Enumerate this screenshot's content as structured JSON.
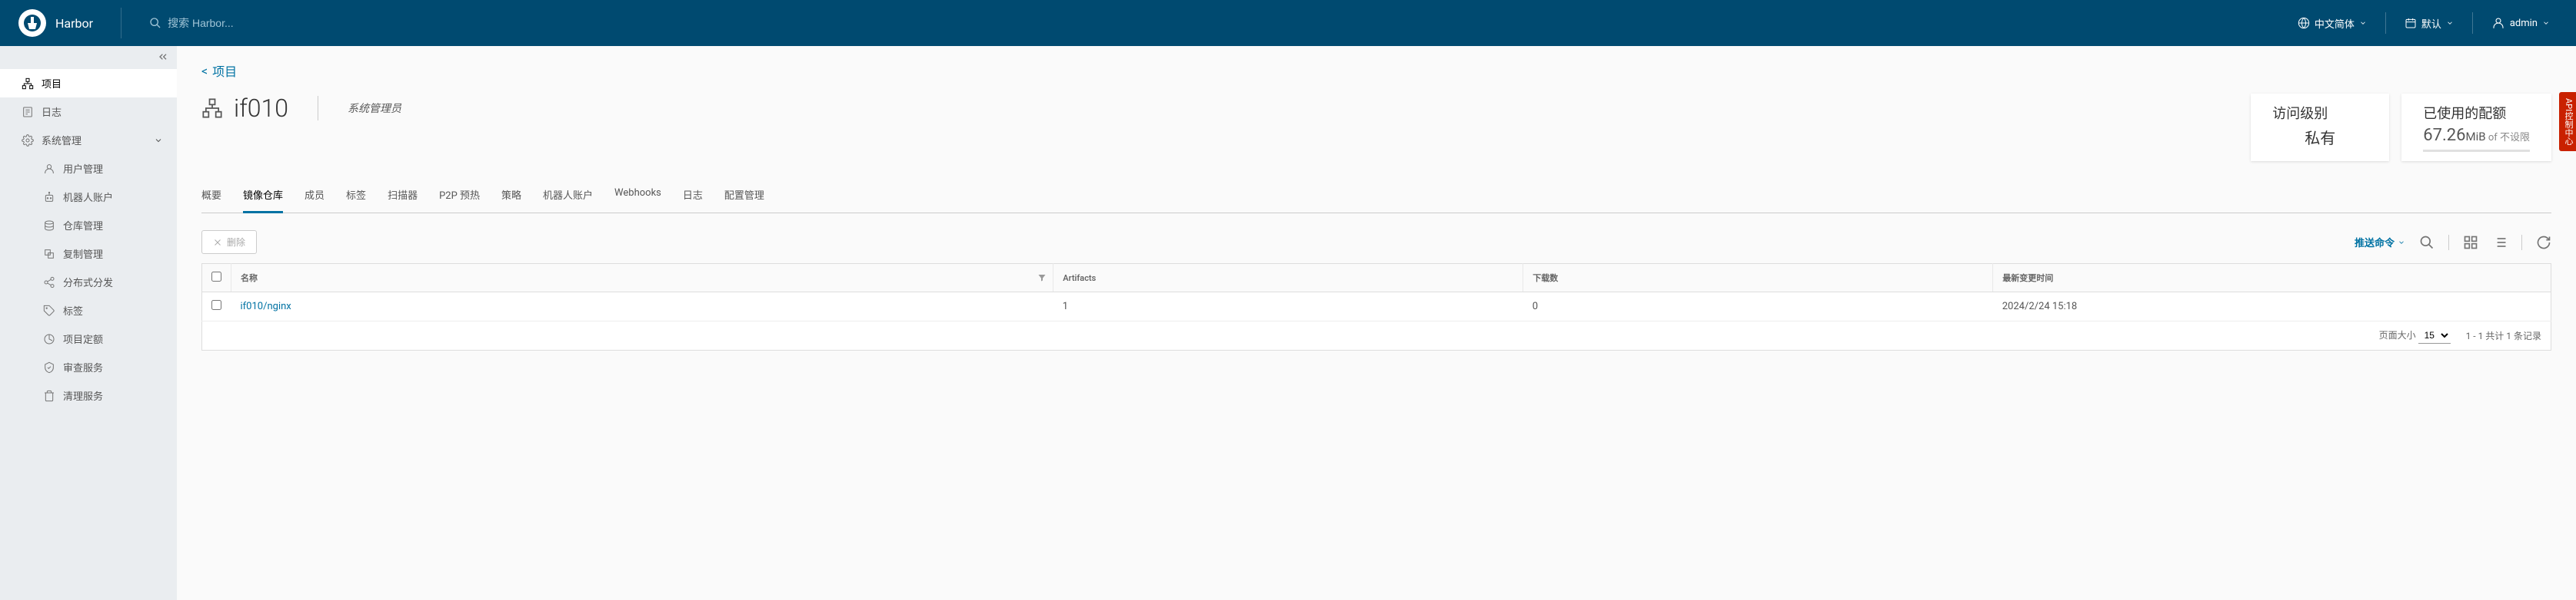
{
  "header": {
    "app_name": "Harbor",
    "search_placeholder": "搜索 Harbor...",
    "lang_label": "中文简体",
    "theme_label": "默认",
    "user_label": "admin"
  },
  "sidebar": {
    "items": [
      {
        "icon": "projects",
        "label": "项目",
        "active": true
      },
      {
        "icon": "logs",
        "label": "日志"
      },
      {
        "icon": "gear",
        "label": "系统管理",
        "expandable": true
      },
      {
        "icon": "user",
        "label": "用户管理",
        "child": true
      },
      {
        "icon": "robot",
        "label": "机器人账户",
        "child": true
      },
      {
        "icon": "repo",
        "label": "仓库管理",
        "child": true
      },
      {
        "icon": "replication",
        "label": "复制管理",
        "child": true
      },
      {
        "icon": "distribution",
        "label": "分布式分发",
        "child": true
      },
      {
        "icon": "tag",
        "label": "标签",
        "child": true
      },
      {
        "icon": "quota",
        "label": "项目定额",
        "child": true
      },
      {
        "icon": "audit",
        "label": "审查服务",
        "child": true
      },
      {
        "icon": "cleanup",
        "label": "清理服务",
        "child": true
      }
    ]
  },
  "breadcrumb": {
    "back_label": "项目"
  },
  "project": {
    "name": "if010",
    "role": "系统管理员",
    "access_card": {
      "title": "访问级别",
      "value": "私有"
    },
    "quota_card": {
      "title": "已使用的配额",
      "value_num": "67.26",
      "value_unit": "MiB",
      "of": "of",
      "limit": "不设限"
    }
  },
  "tabs": [
    {
      "label": "概要"
    },
    {
      "label": "镜像仓库",
      "active": true
    },
    {
      "label": "成员"
    },
    {
      "label": "标签"
    },
    {
      "label": "扫描器"
    },
    {
      "label": "P2P 预热"
    },
    {
      "label": "策略"
    },
    {
      "label": "机器人账户"
    },
    {
      "label": "Webhooks"
    },
    {
      "label": "日志"
    },
    {
      "label": "配置管理"
    }
  ],
  "toolbar": {
    "delete_label": "删除",
    "push_cmd_label": "推送命令"
  },
  "table": {
    "columns": {
      "name": "名称",
      "artifacts": "Artifacts",
      "pulls": "下载数",
      "updated": "最新变更时间"
    },
    "rows": [
      {
        "name": "if010/nginx",
        "artifacts": "1",
        "pulls": "0",
        "updated": "2024/2/24 15:18"
      }
    ],
    "footer": {
      "page_size_label": "页面大小",
      "page_size_value": "15",
      "range_text": "1 - 1 共计 1 条记录"
    }
  },
  "right_tab": {
    "label": "API控制中心"
  }
}
